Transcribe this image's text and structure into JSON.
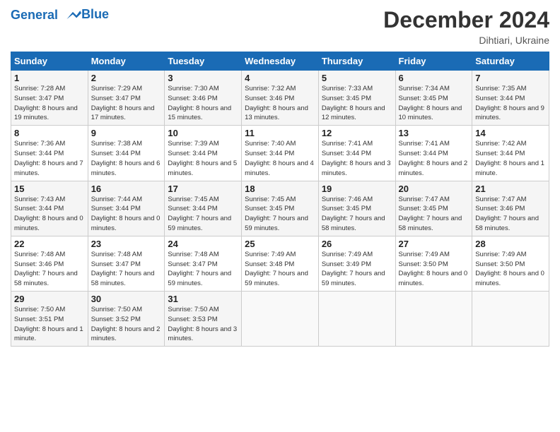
{
  "header": {
    "logo_line1": "General",
    "logo_line2": "Blue",
    "month_title": "December 2024",
    "location": "Dihtiari, Ukraine"
  },
  "days_of_week": [
    "Sunday",
    "Monday",
    "Tuesday",
    "Wednesday",
    "Thursday",
    "Friday",
    "Saturday"
  ],
  "weeks": [
    [
      {
        "day": "1",
        "sunrise": "7:28 AM",
        "sunset": "3:47 PM",
        "daylight": "8 hours and 19 minutes."
      },
      {
        "day": "2",
        "sunrise": "7:29 AM",
        "sunset": "3:47 PM",
        "daylight": "8 hours and 17 minutes."
      },
      {
        "day": "3",
        "sunrise": "7:30 AM",
        "sunset": "3:46 PM",
        "daylight": "8 hours and 15 minutes."
      },
      {
        "day": "4",
        "sunrise": "7:32 AM",
        "sunset": "3:46 PM",
        "daylight": "8 hours and 13 minutes."
      },
      {
        "day": "5",
        "sunrise": "7:33 AM",
        "sunset": "3:45 PM",
        "daylight": "8 hours and 12 minutes."
      },
      {
        "day": "6",
        "sunrise": "7:34 AM",
        "sunset": "3:45 PM",
        "daylight": "8 hours and 10 minutes."
      },
      {
        "day": "7",
        "sunrise": "7:35 AM",
        "sunset": "3:44 PM",
        "daylight": "8 hours and 9 minutes."
      }
    ],
    [
      {
        "day": "8",
        "sunrise": "7:36 AM",
        "sunset": "3:44 PM",
        "daylight": "8 hours and 7 minutes."
      },
      {
        "day": "9",
        "sunrise": "7:38 AM",
        "sunset": "3:44 PM",
        "daylight": "8 hours and 6 minutes."
      },
      {
        "day": "10",
        "sunrise": "7:39 AM",
        "sunset": "3:44 PM",
        "daylight": "8 hours and 5 minutes."
      },
      {
        "day": "11",
        "sunrise": "7:40 AM",
        "sunset": "3:44 PM",
        "daylight": "8 hours and 4 minutes."
      },
      {
        "day": "12",
        "sunrise": "7:41 AM",
        "sunset": "3:44 PM",
        "daylight": "8 hours and 3 minutes."
      },
      {
        "day": "13",
        "sunrise": "7:41 AM",
        "sunset": "3:44 PM",
        "daylight": "8 hours and 2 minutes."
      },
      {
        "day": "14",
        "sunrise": "7:42 AM",
        "sunset": "3:44 PM",
        "daylight": "8 hours and 1 minute."
      }
    ],
    [
      {
        "day": "15",
        "sunrise": "7:43 AM",
        "sunset": "3:44 PM",
        "daylight": "8 hours and 0 minutes."
      },
      {
        "day": "16",
        "sunrise": "7:44 AM",
        "sunset": "3:44 PM",
        "daylight": "8 hours and 0 minutes."
      },
      {
        "day": "17",
        "sunrise": "7:45 AM",
        "sunset": "3:44 PM",
        "daylight": "7 hours and 59 minutes."
      },
      {
        "day": "18",
        "sunrise": "7:45 AM",
        "sunset": "3:45 PM",
        "daylight": "7 hours and 59 minutes."
      },
      {
        "day": "19",
        "sunrise": "7:46 AM",
        "sunset": "3:45 PM",
        "daylight": "7 hours and 58 minutes."
      },
      {
        "day": "20",
        "sunrise": "7:47 AM",
        "sunset": "3:45 PM",
        "daylight": "7 hours and 58 minutes."
      },
      {
        "day": "21",
        "sunrise": "7:47 AM",
        "sunset": "3:46 PM",
        "daylight": "7 hours and 58 minutes."
      }
    ],
    [
      {
        "day": "22",
        "sunrise": "7:48 AM",
        "sunset": "3:46 PM",
        "daylight": "7 hours and 58 minutes."
      },
      {
        "day": "23",
        "sunrise": "7:48 AM",
        "sunset": "3:47 PM",
        "daylight": "7 hours and 58 minutes."
      },
      {
        "day": "24",
        "sunrise": "7:48 AM",
        "sunset": "3:47 PM",
        "daylight": "7 hours and 59 minutes."
      },
      {
        "day": "25",
        "sunrise": "7:49 AM",
        "sunset": "3:48 PM",
        "daylight": "7 hours and 59 minutes."
      },
      {
        "day": "26",
        "sunrise": "7:49 AM",
        "sunset": "3:49 PM",
        "daylight": "7 hours and 59 minutes."
      },
      {
        "day": "27",
        "sunrise": "7:49 AM",
        "sunset": "3:50 PM",
        "daylight": "8 hours and 0 minutes."
      },
      {
        "day": "28",
        "sunrise": "7:49 AM",
        "sunset": "3:50 PM",
        "daylight": "8 hours and 0 minutes."
      }
    ],
    [
      {
        "day": "29",
        "sunrise": "7:50 AM",
        "sunset": "3:51 PM",
        "daylight": "8 hours and 1 minute."
      },
      {
        "day": "30",
        "sunrise": "7:50 AM",
        "sunset": "3:52 PM",
        "daylight": "8 hours and 2 minutes."
      },
      {
        "day": "31",
        "sunrise": "7:50 AM",
        "sunset": "3:53 PM",
        "daylight": "8 hours and 3 minutes."
      },
      null,
      null,
      null,
      null
    ]
  ]
}
